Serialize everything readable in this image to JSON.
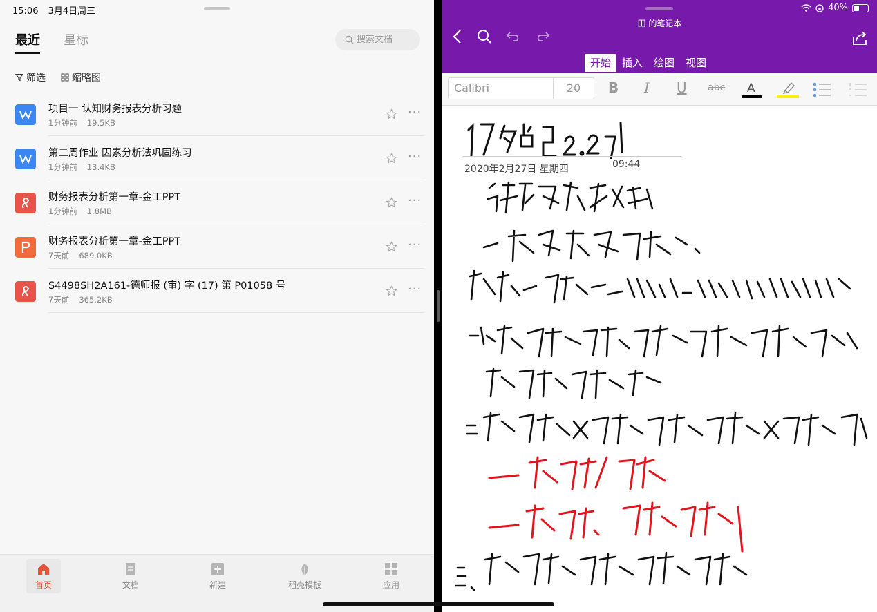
{
  "left": {
    "status": {
      "time": "15:06",
      "date": "3月4日周三"
    },
    "tabs": [
      {
        "label": "最近"
      },
      {
        "label": "星标"
      }
    ],
    "search": {
      "placeholder": "搜索文档"
    },
    "filters": {
      "filter_label": "筛选",
      "thumbnail_label": "缩略图"
    },
    "files": [
      {
        "name": "项目一 认知财务报表分析习题",
        "time": "1分钟前",
        "size": "19.5KB",
        "type": "word"
      },
      {
        "name": "第二周作业 因素分析法巩固练习",
        "time": "1分钟前",
        "size": "13.4KB",
        "type": "word"
      },
      {
        "name": "财务报表分析第一章-金工PPT",
        "time": "1分钟前",
        "size": "1.8MB",
        "type": "pdf"
      },
      {
        "name": "财务报表分析第一章-金工PPT",
        "time": "7天前",
        "size": "689.0KB",
        "type": "ppt"
      },
      {
        "name": "S4498SH2A161-德师报 (审) 字 (17) 第 P01058 号",
        "time": "7天前",
        "size": "365.2KB",
        "type": "pdf"
      }
    ],
    "nav": [
      {
        "label": "首页",
        "icon": "home-icon"
      },
      {
        "label": "文档",
        "icon": "document-icon"
      },
      {
        "label": "新建",
        "icon": "plus-icon"
      },
      {
        "label": "稻壳模板",
        "icon": "leaf-icon"
      },
      {
        "label": "应用",
        "icon": "grid-icon"
      }
    ],
    "colors": {
      "accent": "#e5533c",
      "word": "#3b86f0",
      "pdf": "#e8534a",
      "ppt": "#f26b3a"
    }
  },
  "right": {
    "status": {
      "battery": "40%"
    },
    "notebook_title": "田 的笔记本",
    "tabs": [
      {
        "label": "开始"
      },
      {
        "label": "插入"
      },
      {
        "label": "绘图"
      },
      {
        "label": "视图"
      }
    ],
    "toolbar": {
      "font_name": "Calibri",
      "font_size": "20"
    },
    "note": {
      "date": "2020年2月27日 星期四",
      "time": "09:44"
    },
    "colors": {
      "header": "#7719aa",
      "ink": "#111111",
      "red_ink": "#e0161e",
      "highlight": "#ffef00"
    }
  }
}
